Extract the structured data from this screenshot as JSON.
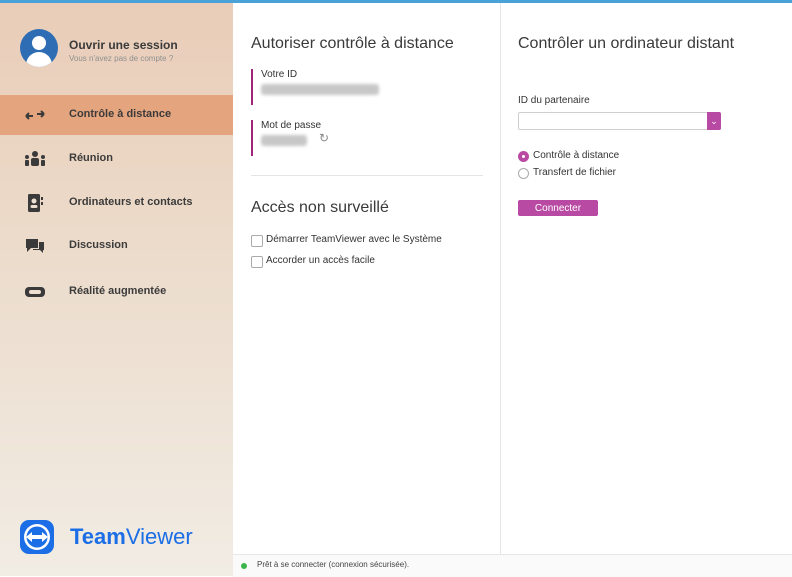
{
  "sidebar": {
    "profile": {
      "title": "Ouvrir une session",
      "subtitle": "Vous n'avez pas de compte ?"
    },
    "items": [
      {
        "label": "Contrôle à distance",
        "icon": "arrows-icon",
        "active": true
      },
      {
        "label": "Réunion",
        "icon": "meeting-icon",
        "active": false
      },
      {
        "label": "Ordinateurs et contacts",
        "icon": "contacts-icon",
        "active": false
      },
      {
        "label": "Discussion",
        "icon": "chat-icon",
        "active": false
      },
      {
        "label": "Réalité augmentée",
        "icon": "ar-icon",
        "active": false
      }
    ],
    "logo": {
      "bold": "Team",
      "light": "Viewer"
    }
  },
  "allow": {
    "title": "Autoriser contrôle à distance",
    "id_label": "Votre ID",
    "password_label": "Mot de passe"
  },
  "unattended": {
    "title": "Accès non surveillé",
    "options": [
      {
        "label": "Démarrer TeamViewer avec le Système",
        "checked": false
      },
      {
        "label": "Accorder un accès facile",
        "checked": false
      }
    ]
  },
  "control": {
    "title": "Contrôler un ordinateur distant",
    "partner_label": "ID du partenaire",
    "partner_value": "",
    "modes": [
      {
        "label": "Contrôle à distance",
        "selected": true
      },
      {
        "label": "Transfert de fichier",
        "selected": false
      }
    ],
    "connect_label": "Connecter"
  },
  "status": {
    "text": "Prêt à se connecter (connexion sécurisée).",
    "color": "#3bb54a"
  },
  "colors": {
    "accent": "#b94aa3",
    "active_nav": "#e4a47d",
    "brand": "#1b6ee6"
  }
}
